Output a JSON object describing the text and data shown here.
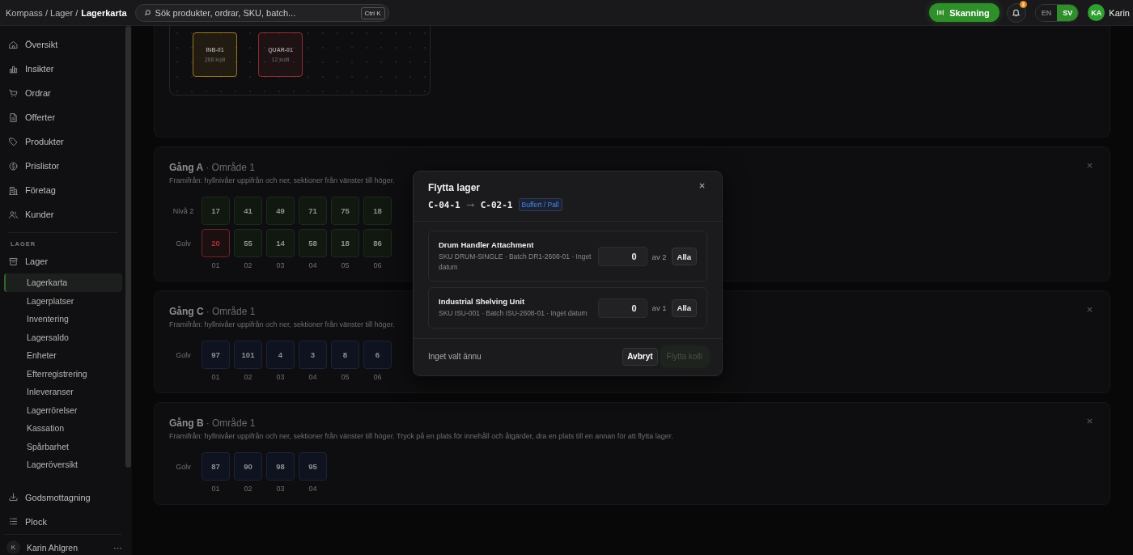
{
  "topbar": {
    "breadcrumb": {
      "path": "Kompass / Lager /",
      "current": "Lagerkarta"
    },
    "search": {
      "placeholder": "Sök produkter, ordrar, SKU, batch...",
      "shortcut": "Ctrl K"
    },
    "scan_button": "Skanning",
    "notifications": {
      "count": "3"
    },
    "languages": [
      {
        "label": "EN",
        "selected": false
      },
      {
        "label": "SV",
        "selected": true
      }
    ],
    "user": {
      "initials": "KA",
      "name": "Karin"
    }
  },
  "sidebar": {
    "items": [
      {
        "label": "Översikt"
      },
      {
        "label": "Insikter"
      },
      {
        "label": "Ordrar"
      },
      {
        "label": "Offerter"
      },
      {
        "label": "Produkter"
      },
      {
        "label": "Prislistor"
      },
      {
        "label": "Företag"
      },
      {
        "label": "Kunder"
      }
    ],
    "section_label": "LAGER",
    "group": {
      "label": "Lager",
      "children": [
        {
          "label": "Lagerkarta",
          "selected": true
        },
        {
          "label": "Lagerplatser",
          "selected": false
        },
        {
          "label": "Inventering",
          "selected": false
        },
        {
          "label": "Lagersaldo",
          "selected": false
        },
        {
          "label": "Enheter",
          "selected": false
        },
        {
          "label": "Efterregistrering",
          "selected": false
        },
        {
          "label": "Inleveranser",
          "selected": false
        },
        {
          "label": "Lagerrörelser",
          "selected": false
        },
        {
          "label": "Kassation",
          "selected": false
        },
        {
          "label": "Spårbarhet",
          "selected": false
        },
        {
          "label": "Lageröversikt",
          "selected": false
        }
      ]
    },
    "items_after": [
      {
        "label": "Godsmottagning"
      },
      {
        "label": "Plock"
      }
    ],
    "account": {
      "initial": "K",
      "name": "Karin Ahlgren",
      "menu": "···"
    }
  },
  "main": {
    "zones": [
      {
        "code": "INB-01",
        "count": "268 kolli",
        "color": "#9a7424"
      },
      {
        "code": "QUAR-01",
        "count": "12 kolli",
        "color": "#8c2f33"
      }
    ],
    "aisles": [
      {
        "title": "Gång A",
        "area": "· Område 1",
        "description": "Framifrån: hyllnivåer uppifrån och ner, sektioner från vänster till höger.",
        "levels": [
          {
            "label": "Nivå 2",
            "cells": [
              {
                "value": "17",
                "kind": "stocked"
              },
              {
                "value": "41",
                "kind": "stocked"
              },
              {
                "value": "49",
                "kind": "stocked"
              },
              {
                "value": "71",
                "kind": "stocked"
              },
              {
                "value": "75",
                "kind": "stocked"
              },
              {
                "value": "18",
                "kind": "stocked"
              }
            ]
          },
          {
            "label": "Golv",
            "cells": [
              {
                "value": "20",
                "kind": "warning"
              },
              {
                "value": "55",
                "kind": "stocked"
              },
              {
                "value": "14",
                "kind": "stocked"
              },
              {
                "value": "58",
                "kind": "stocked"
              },
              {
                "value": "18",
                "kind": "stocked"
              },
              {
                "value": "86",
                "kind": "stocked"
              }
            ]
          }
        ],
        "sections": [
          "01",
          "02",
          "03",
          "04",
          "05",
          "06"
        ]
      },
      {
        "title": "Gång C",
        "area": "· Område 1",
        "description": "Framifrån: hyllnivåer uppifrån och ner, sektioner från vänster till höger.",
        "levels": [
          {
            "label": "Golv",
            "cells": [
              {
                "value": "97",
                "kind": "idle"
              },
              {
                "value": "101",
                "kind": "idle"
              },
              {
                "value": "4",
                "kind": "idle"
              },
              {
                "value": "3",
                "kind": "idle"
              },
              {
                "value": "8",
                "kind": "idle"
              },
              {
                "value": "6",
                "kind": "idle"
              }
            ]
          }
        ],
        "sections": [
          "01",
          "02",
          "03",
          "04",
          "05",
          "06"
        ]
      },
      {
        "title": "Gång B",
        "area": "· Område 1",
        "description": "Framifrån: hyllnivåer uppifrån och ner, sektioner från vänster till höger. Tryck på en plats för innehåll och åtgärder, dra en plats till en annan för att flytta lager.",
        "levels": [
          {
            "label": "Golv",
            "cells": [
              {
                "value": "87",
                "kind": "idle"
              },
              {
                "value": "90",
                "kind": "idle"
              },
              {
                "value": "98",
                "kind": "idle"
              },
              {
                "value": "95",
                "kind": "idle"
              }
            ]
          }
        ],
        "sections": [
          "01",
          "02",
          "03",
          "04"
        ]
      }
    ]
  },
  "dialog": {
    "title": "Flytta lager",
    "from": "C-04-1",
    "to": "C-02-1",
    "tag": "Buffert / Pall",
    "items": [
      {
        "name": "Drum Handler Attachment",
        "meta": "SKU DRUM-SINGLE · Batch DR1-2608-01 · Inget datum",
        "quantity": "0",
        "available": "av 2",
        "all_button": "Alla"
      },
      {
        "name": "Industrial Shelving Unit",
        "meta": "SKU ISU-001 · Batch ISU-2608-01 · Inget datum",
        "quantity": "0",
        "available": "av 1",
        "all_button": "Alla"
      }
    ],
    "summary": "Inget valt ännu",
    "cancel": "Avbryt",
    "submit": {
      "label": "Flytta kolli",
      "disabled": true
    }
  }
}
